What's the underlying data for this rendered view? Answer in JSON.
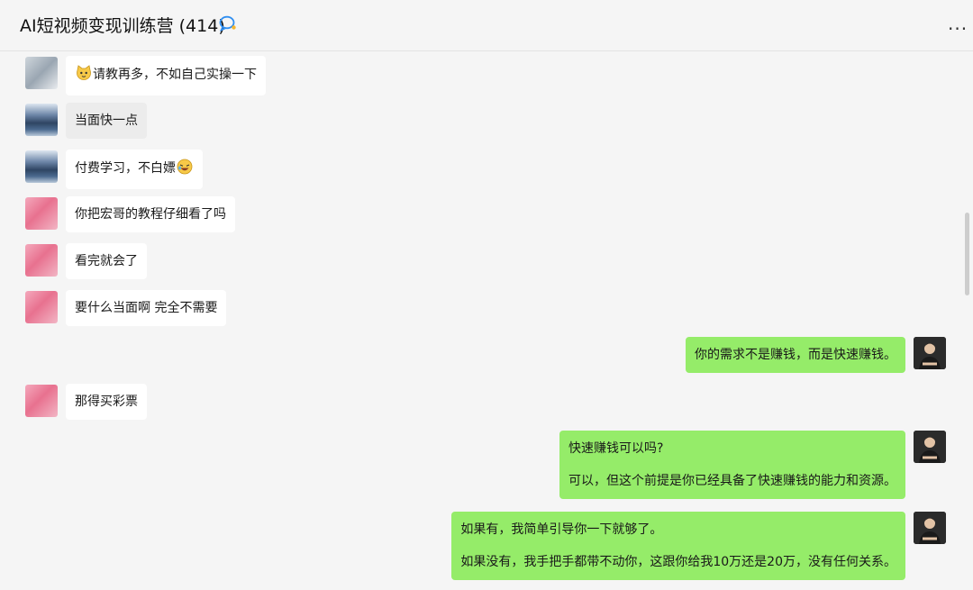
{
  "header": {
    "title": "AI短视频变现训练营 (414)",
    "more": "..."
  },
  "messages": [
    {
      "text": "请教再多，不如自己实操一下",
      "emoji": "cat-face-icon"
    },
    {
      "text": "当面快一点"
    },
    {
      "text": "付费学习，不白嫖",
      "emoji": "laughing-face-icon"
    },
    {
      "text": "你把宏哥的教程仔细看了吗"
    },
    {
      "text": "看完就会了"
    },
    {
      "text": "要什么当面啊 完全不需要"
    },
    {
      "text": "你的需求不是赚钱，而是快速赚钱。"
    },
    {
      "text": "那得买彩票"
    },
    {
      "line1": "快速赚钱可以吗?",
      "line2": "可以，但这个前提是你已经具备了快速赚钱的能力和资源。"
    },
    {
      "line1": "如果有，我简单引导你一下就够了。",
      "line2": "如果没有，我手把手都带不动你，这跟你给我10万还是20万，没有任何关系。"
    }
  ],
  "colors": {
    "background": "#f5f5f5",
    "incoming_bubble": "#ffffff",
    "outgoing_bubble": "#95ec69"
  }
}
